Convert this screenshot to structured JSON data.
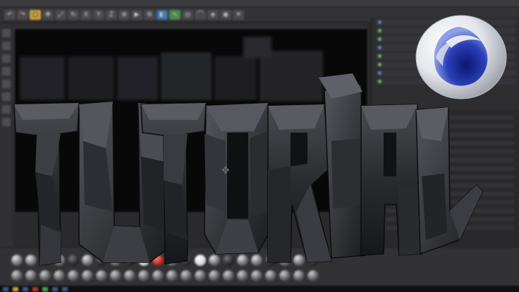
{
  "artwork": {
    "title_text": "TUTOR",
    "logo": "cinema-4d-logo"
  },
  "colors": {
    "background": "#2a2a2c",
    "viewport": "#080809",
    "accent": "#c8a23a",
    "logo_blue": "#2b3fb8"
  },
  "icons": {
    "menu": "menubar",
    "tools": "toolbar-tool-icons",
    "materials": "material-preview-spheres"
  }
}
